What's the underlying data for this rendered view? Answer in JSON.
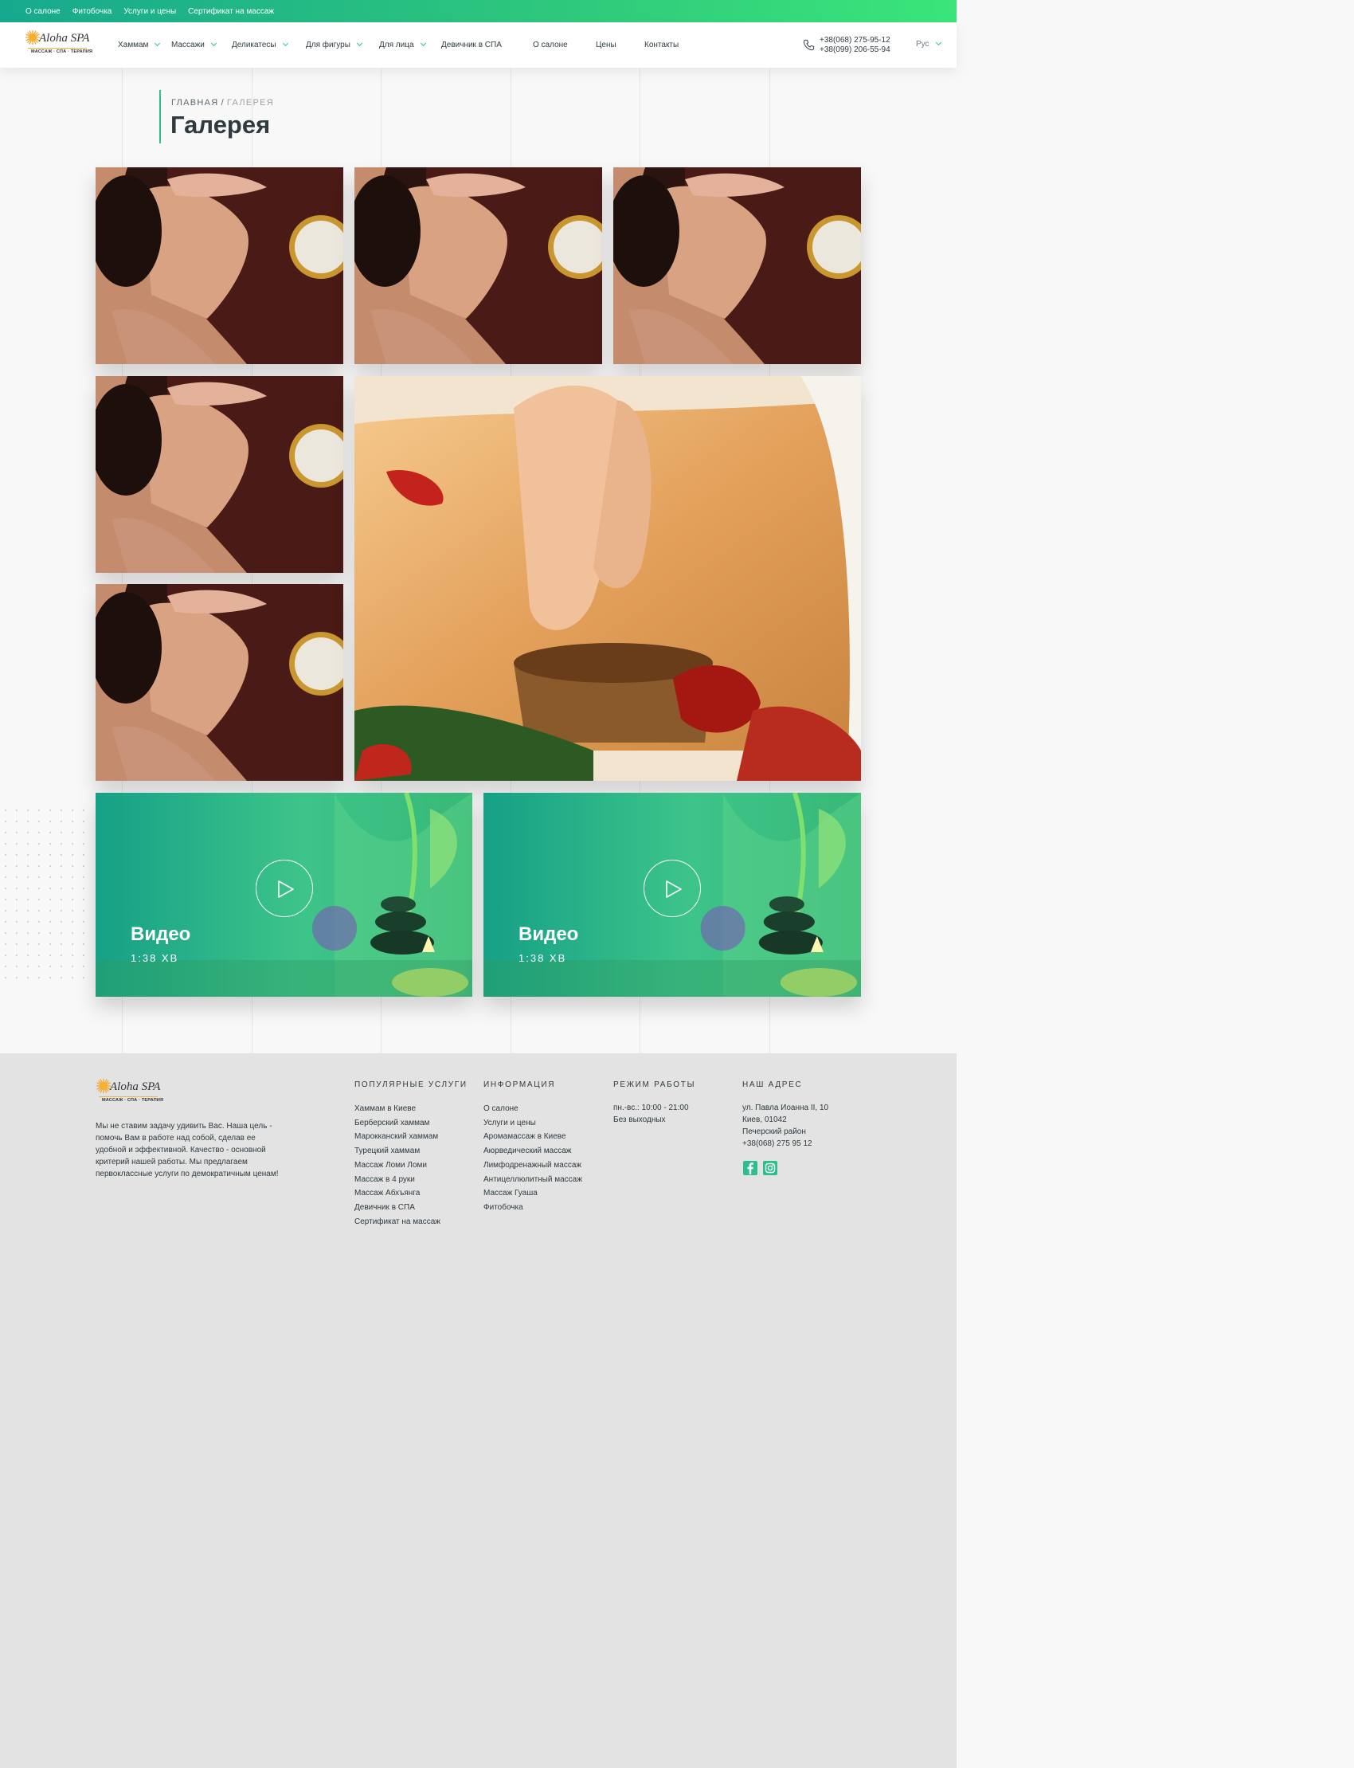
{
  "topbar": {
    "links": [
      "О салоне",
      "Фитобочка",
      "Услуги и цены",
      "Сертификат на массаж"
    ]
  },
  "header": {
    "logo": {
      "name": "Aloha SPA",
      "tagline": "МАССАЖ · СПА · ТЕРАПИЯ"
    },
    "nav": [
      {
        "label": "Хаммам",
        "dropdown": true
      },
      {
        "label": "Массажи",
        "dropdown": true
      },
      {
        "label": "Деликатесы",
        "dropdown": true
      },
      {
        "label": "Для фигуры",
        "dropdown": true
      },
      {
        "label": "Для лица",
        "dropdown": true
      },
      {
        "label": "Девичник в СПА",
        "dropdown": false
      },
      {
        "label": "О салоне",
        "dropdown": false
      },
      {
        "label": "Цены",
        "dropdown": false
      },
      {
        "label": "Контакты",
        "dropdown": false
      }
    ],
    "phones": [
      "+38(068) 275-95-12",
      "+38(099) 206-55-94"
    ],
    "language": "Рус"
  },
  "page": {
    "breadcrumb": {
      "home": "ГЛАВНАЯ",
      "separator": "/",
      "current": "ГАЛЕРЕЯ"
    },
    "title": "Галерея"
  },
  "videos": [
    {
      "title": "Видео",
      "duration": "1:38 ХВ"
    },
    {
      "title": "Видео",
      "duration": "1:38 ХВ"
    }
  ],
  "footer": {
    "about": "Мы не ставим задачу удивить Вас. Наша цель - помочь Вам в работе над собой, сделав ее удобной и эффективной. Качество - основной критерий нашей работы. Мы предлагаем первоклассные услуги по демократичным ценам!",
    "popular": {
      "heading": "ПОПУЛЯРНЫЕ УСЛУГИ",
      "items": [
        "Хаммам в Киеве",
        "Берберский хаммам",
        "Марокканский хаммам",
        "Турецкий хаммам",
        "Массаж Ломи Ломи",
        "Массаж в 4 руки",
        "Массаж Абхъянга",
        "Девичник в СПА",
        "Сертификат на массаж"
      ]
    },
    "info": {
      "heading": "ИНФОРМАЦИЯ",
      "items": [
        "О салоне",
        "Услуги и цены",
        "Аромамассаж в Киеве",
        "Аюрведический массаж",
        "Лимфодренажный массаж",
        "Антицеллюлитный массаж",
        "Массаж Гуаша",
        "Фитобочка"
      ]
    },
    "hours": {
      "heading": "РЕЖИМ РАБОТЫ",
      "lines": [
        "пн.-вс.: 10:00 - 21:00",
        "Без выходных"
      ]
    },
    "address": {
      "heading": "НАШ АДРЕС",
      "lines": [
        "ул. Павла Иоанна II, 10",
        "Киев, 01042",
        "Печерский район",
        "+38(068) 275 95 12"
      ]
    },
    "social": [
      "facebook-icon",
      "instagram-icon"
    ]
  },
  "colors": {
    "accent": "#2bc08b",
    "topbar_start": "#17a98e",
    "topbar_end": "#3be57a",
    "text": "#2f3a40"
  }
}
